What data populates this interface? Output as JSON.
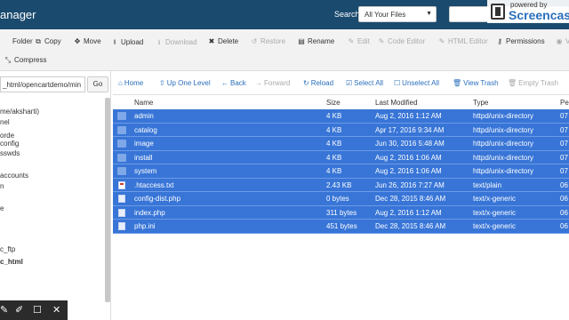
{
  "header": {
    "title": "anager",
    "search_label": "Search",
    "search_scope": "All Your Files",
    "watermark_top": "powered by",
    "watermark_brand": "Screencas"
  },
  "toolbar": {
    "row1": [
      {
        "label": "Folder",
        "icon": "folder-plus-icon",
        "glyph": "",
        "disabled": false
      },
      {
        "label": "Copy",
        "icon": "copy-icon",
        "glyph": "⧉",
        "disabled": false
      },
      {
        "label": "Move",
        "icon": "move-icon",
        "glyph": "✥",
        "disabled": false
      },
      {
        "label": "Upload",
        "icon": "upload-icon",
        "glyph": "⭱",
        "disabled": false
      },
      {
        "label": "Download",
        "icon": "download-icon",
        "glyph": "⭳",
        "disabled": true
      },
      {
        "label": "Delete",
        "icon": "delete-icon",
        "glyph": "✖",
        "disabled": false
      },
      {
        "label": "Restore",
        "icon": "restore-icon",
        "glyph": "↺",
        "disabled": true
      },
      {
        "label": "Rename",
        "icon": "rename-icon",
        "glyph": "▤",
        "disabled": false
      },
      {
        "label": "Edit",
        "icon": "edit-icon",
        "glyph": "✎",
        "disabled": true
      },
      {
        "label": "Code Editor",
        "icon": "code-editor-icon",
        "glyph": "✎",
        "disabled": true
      },
      {
        "label": "HTML Editor",
        "icon": "html-editor-icon",
        "glyph": "✎",
        "disabled": true
      },
      {
        "label": "Permissions",
        "icon": "key-icon",
        "glyph": "⚷",
        "disabled": false
      },
      {
        "label": "V",
        "icon": "view-icon",
        "glyph": "◉",
        "disabled": true
      }
    ],
    "compress": {
      "label": "Compress",
      "icon": "compress-icon",
      "glyph": "⤡"
    }
  },
  "sidebar": {
    "path_value": "_html/opencartdemo/min",
    "go_label": "Go",
    "tree": [
      "me/aksharti)",
      "nel",
      "orde",
      "config",
      "sswds",
      "accounts",
      "n",
      "e",
      "c_ftp",
      "c_html"
    ]
  },
  "navbar": {
    "items": [
      {
        "label": "Home",
        "icon": "home-icon",
        "glyph": "⌂",
        "disabled": false
      },
      {
        "label": "Up One Level",
        "icon": "up-level-icon",
        "glyph": "⇧",
        "disabled": false
      },
      {
        "label": "Back",
        "icon": "back-icon",
        "glyph": "←",
        "disabled": false
      },
      {
        "label": "Forward",
        "icon": "forward-icon",
        "glyph": "→",
        "disabled": true
      },
      {
        "label": "Reload",
        "icon": "reload-icon",
        "glyph": "↻",
        "disabled": false
      },
      {
        "label": "Select All",
        "icon": "select-all-icon",
        "glyph": "☑",
        "disabled": false
      },
      {
        "label": "Unselect All",
        "icon": "unselect-all-icon",
        "glyph": "☐",
        "disabled": false
      },
      {
        "label": "View Trash",
        "icon": "trash-icon",
        "glyph": "🗑",
        "disabled": false
      },
      {
        "label": "Empty Trash",
        "icon": "empty-trash-icon",
        "glyph": "🗑",
        "disabled": true
      }
    ]
  },
  "table": {
    "columns": [
      "Name",
      "Size",
      "Last Modified",
      "Type",
      "Pe"
    ],
    "rows": [
      {
        "kind": "folder",
        "name": "admin",
        "size": "4 KB",
        "modified": "Aug 2, 2016 1:12 AM",
        "type": "httpd/unix-directory",
        "perm": "07"
      },
      {
        "kind": "folder",
        "name": "catalog",
        "size": "4 KB",
        "modified": "Apr 17, 2016 9:34 AM",
        "type": "httpd/unix-directory",
        "perm": "07"
      },
      {
        "kind": "folder",
        "name": "image",
        "size": "4 KB",
        "modified": "Jun 30, 2016 5:48 AM",
        "type": "httpd/unix-directory",
        "perm": "07"
      },
      {
        "kind": "folder",
        "name": "install",
        "size": "4 KB",
        "modified": "Aug 2, 2016 1:06 AM",
        "type": "httpd/unix-directory",
        "perm": "07"
      },
      {
        "kind": "folder",
        "name": "system",
        "size": "4 KB",
        "modified": "Aug 2, 2016 1:06 AM",
        "type": "httpd/unix-directory",
        "perm": "07"
      },
      {
        "kind": "text",
        "name": ".htaccess.txt",
        "size": "2.43 KB",
        "modified": "Jun 26, 2016 7:27 AM",
        "type": "text/plain",
        "perm": "06"
      },
      {
        "kind": "file",
        "name": "config-dist.php",
        "size": "0 bytes",
        "modified": "Dec 28, 2015 8:46 AM",
        "type": "text/x-generic",
        "perm": "06"
      },
      {
        "kind": "file",
        "name": "index.php",
        "size": "311 bytes",
        "modified": "Aug 2, 2016 1:12 AM",
        "type": "text/x-generic",
        "perm": "06"
      },
      {
        "kind": "file",
        "name": "php.ini",
        "size": "451 bytes",
        "modified": "Dec 28, 2015 8:46 AM",
        "type": "text/x-generic",
        "perm": "06"
      }
    ]
  },
  "floating_toolbar": [
    "pen-icon",
    "highlighter-icon",
    "rectangle-icon",
    "close-icon"
  ],
  "colors": {
    "header": "#1a4a6e",
    "selection": "#3875d7",
    "link": "#2a6ebb"
  }
}
